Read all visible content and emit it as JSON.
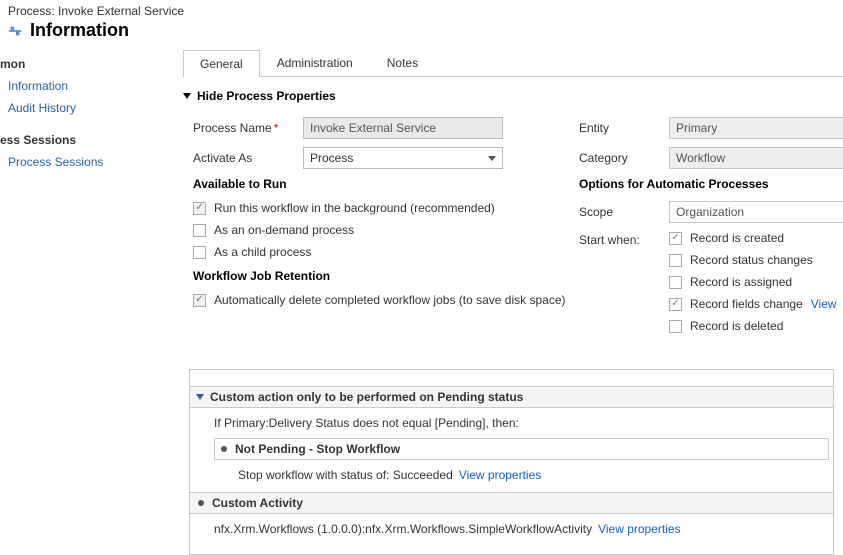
{
  "header": {
    "context": "Process: Invoke External Service",
    "title": "Information"
  },
  "sidebar": {
    "sections": [
      {
        "head": "mon",
        "items": [
          "Information",
          "Audit History"
        ]
      },
      {
        "head": "ess Sessions",
        "items": [
          "Process Sessions"
        ]
      }
    ]
  },
  "tabs": [
    "General",
    "Administration",
    "Notes"
  ],
  "active_tab": 0,
  "section_toggle": "Hide Process Properties",
  "form": {
    "process_name_label": "Process Name",
    "process_name_value": "Invoke External Service",
    "activate_as_label": "Activate As",
    "activate_as_value": "Process",
    "entity_label": "Entity",
    "entity_value": "Primary",
    "category_label": "Category",
    "category_value": "Workflow"
  },
  "available": {
    "head": "Available to Run",
    "opts": [
      {
        "label": "Run this workflow in the background (recommended)",
        "checked": true,
        "disabled": true
      },
      {
        "label": "As an on-demand process",
        "checked": false,
        "disabled": false
      },
      {
        "label": "As a child process",
        "checked": false,
        "disabled": false
      }
    ]
  },
  "retention": {
    "head": "Workflow Job Retention",
    "opt": {
      "label": "Automatically delete completed workflow jobs (to save disk space)",
      "checked": true,
      "disabled": true
    }
  },
  "options": {
    "head": "Options for Automatic Processes",
    "scope_label": "Scope",
    "scope_value": "Organization",
    "start_label": "Start when:",
    "triggers": [
      {
        "label": "Record is created",
        "checked": true,
        "link": null
      },
      {
        "label": "Record status changes",
        "checked": false,
        "link": null
      },
      {
        "label": "Record is assigned",
        "checked": false,
        "link": null
      },
      {
        "label": "Record fields change",
        "checked": true,
        "link": "View"
      },
      {
        "label": "Record is deleted",
        "checked": false,
        "link": null
      }
    ]
  },
  "steps": {
    "s1": {
      "title": "Custom action only to be performed on Pending status",
      "cond": "If Primary:Delivery Status does not equal [Pending], then:",
      "sub_title": "Not Pending - Stop Workflow",
      "sub_detail": "Stop workflow with status of:  Succeeded",
      "sub_link": "View properties"
    },
    "s2": {
      "title": "Custom Activity",
      "detail": "nfx.Xrm.Workflows (1.0.0.0):nfx.Xrm.Workflows.SimpleWorkflowActivity",
      "link": "View properties"
    }
  }
}
